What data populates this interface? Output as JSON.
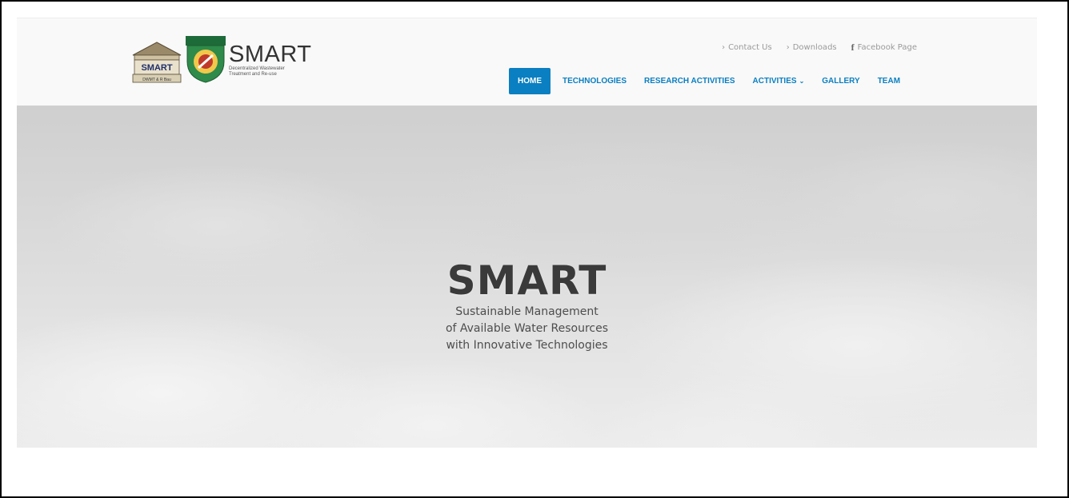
{
  "logo": {
    "building_badge_text": "SMART",
    "building_caption": "DWMT & R Bau",
    "title": "SMART",
    "subtitle": "Decentralized Wastewater Treatment and Re-use"
  },
  "top_links": [
    {
      "label": "Contact Us",
      "icon": "chevron-right-icon"
    },
    {
      "label": "Downloads",
      "icon": "chevron-right-icon"
    },
    {
      "label": "Facebook Page",
      "icon": "facebook-icon"
    }
  ],
  "nav": {
    "home": "HOME",
    "technologies": "TECHNOLOGIES",
    "research": "RESEARCH ACTIVITIES",
    "activities": "ACTIVITIES",
    "gallery": "GALLERY",
    "team": "TEAM"
  },
  "hero": {
    "title": "SMART",
    "line1": "Sustainable Management",
    "line2": "of Available Water Resources",
    "line3": "with Innovative Technologies"
  },
  "colors": {
    "accent": "#0a7fc1",
    "header_bg": "#f9f9f9",
    "hero_text": "#3a3a3a"
  }
}
